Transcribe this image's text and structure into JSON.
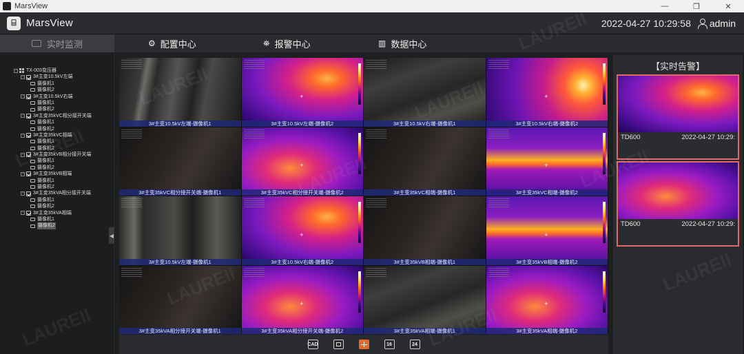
{
  "window": {
    "title": "MarsView",
    "controls": [
      "—",
      "❐",
      "✕"
    ]
  },
  "header": {
    "brand": "MarsView",
    "datetime": "2022-04-27 10:29:58",
    "user": "admin",
    "logo_glyph": "⌸"
  },
  "nav": {
    "monitor": "实时监测",
    "items": [
      {
        "label": "配置中心",
        "icon": "⚙"
      },
      {
        "label": "报警中心",
        "icon": "⛯"
      },
      {
        "label": "数据中心",
        "icon": "▥"
      }
    ]
  },
  "tree": {
    "root": "TX-003变压器",
    "groups": [
      {
        "label": "3#主变10.5kV左端",
        "cams": [
          "摄像机1",
          "摄像机2"
        ]
      },
      {
        "label": "3#主变10.5kV右端",
        "cams": [
          "摄像机1",
          "摄像机2"
        ]
      },
      {
        "label": "3#主变35kVC相分接开关端",
        "cams": [
          "摄像机1",
          "摄像机2"
        ]
      },
      {
        "label": "3#主变35kVC相端",
        "cams": [
          "摄像机1",
          "摄像机2"
        ]
      },
      {
        "label": "3#主变35kVB相分接开关端",
        "cams": [
          "摄像机1",
          "摄像机2"
        ]
      },
      {
        "label": "3#主变35kVB相端",
        "cams": [
          "摄像机1",
          "摄像机2"
        ]
      },
      {
        "label": "3#主变35kVA相分接开关端",
        "cams": [
          "摄像机1",
          "摄像机2"
        ]
      },
      {
        "label": "3#主变35kVA相端",
        "cams": [
          "摄像机1",
          "摄像机2"
        ]
      }
    ]
  },
  "cells": [
    {
      "caption": "3#主变10.5kV左端-摄像机1",
      "kind": "vis-a"
    },
    {
      "caption": "3#主变10.5kV左端-摄像机2",
      "kind": "th-a"
    },
    {
      "caption": "3#主变10.5kV右端-摄像机1",
      "kind": "vis-b"
    },
    {
      "caption": "3#主变10.5kV右端-摄像机2",
      "kind": "th-d"
    },
    {
      "caption": "3#主变35kVC相分接开关端-摄像机1",
      "kind": "vis-c"
    },
    {
      "caption": "3#主变35kVC相分接开关端-摄像机2",
      "kind": "th-b"
    },
    {
      "caption": "3#主变35kVC相端-摄像机1",
      "kind": "vis-c"
    },
    {
      "caption": "3#主变35kVC相端-摄像机2",
      "kind": "th-c"
    },
    {
      "caption": "3#主变10.5kV左端-摄像机1",
      "kind": "vis-d"
    },
    {
      "caption": "3#主变10.5kV右端-摄像机2",
      "kind": "th-a"
    },
    {
      "caption": "3#主变35kVB相端-摄像机1",
      "kind": "vis-c"
    },
    {
      "caption": "3#主变35kVB相端-摄像机2",
      "kind": "th-c"
    },
    {
      "caption": "3#主变35kVA相分接开关端-摄像机1",
      "kind": "vis-c"
    },
    {
      "caption": "3#主变35kVA相分接开关端-摄像机2",
      "kind": "th-b"
    },
    {
      "caption": "3#主变35kVA相端-摄像机1",
      "kind": "vis-b"
    },
    {
      "caption": "3#主变35kVA相端-摄像机2",
      "kind": "th-b"
    }
  ],
  "layouts": [
    {
      "label": "CAD",
      "active": false
    },
    {
      "label": "",
      "active": false
    },
    {
      "label": "",
      "active": true
    },
    {
      "label": "16",
      "active": false
    },
    {
      "label": "24",
      "active": false
    }
  ],
  "alarms": {
    "title": "【实时告警】",
    "items": [
      {
        "device": "TD600",
        "time": "2022-04-27 10:29:",
        "message": "",
        "kind": "th-a"
      },
      {
        "device": "TD600",
        "time": "2022-04-27 10:29:",
        "message": "",
        "kind": "th-b"
      }
    ]
  },
  "watermark": "LAUREII",
  "colors": {
    "accent": "#e26a2c",
    "alarm_border": "#e06a6a",
    "alarm_text": "#e03030"
  }
}
